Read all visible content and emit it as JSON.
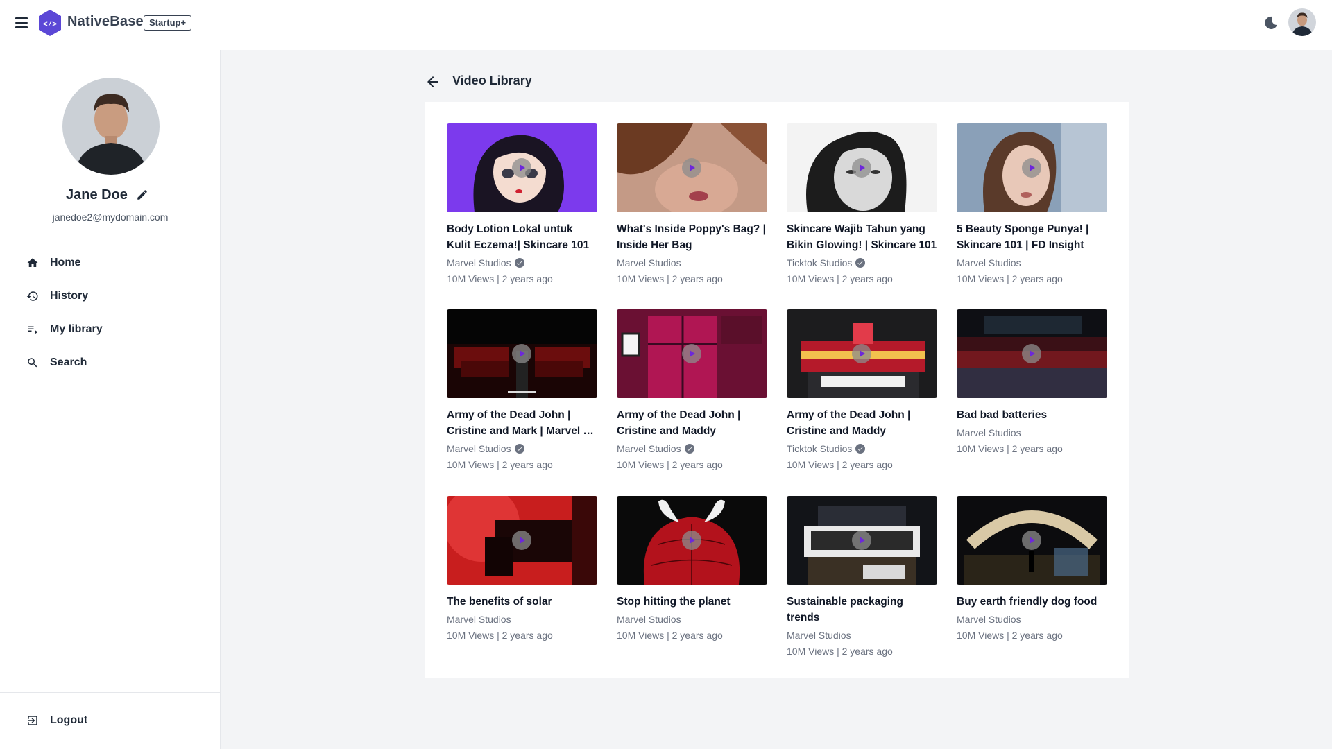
{
  "header": {
    "brand": "NativeBase",
    "badge": "Startup+",
    "icons": [
      "hamburger-menu-icon",
      "logo-icon",
      "moon-icon",
      "user-avatar"
    ]
  },
  "sidebar": {
    "profile": {
      "name": "Jane Doe",
      "email": "janedoe2@mydomain.com"
    },
    "items": [
      {
        "label": "Home",
        "icon": "home-icon"
      },
      {
        "label": "History",
        "icon": "history-icon"
      },
      {
        "label": "My library",
        "icon": "library-icon"
      },
      {
        "label": "Search",
        "icon": "search-icon"
      }
    ],
    "logout": {
      "label": "Logout",
      "icon": "logout-icon"
    }
  },
  "main": {
    "title": "Video Library",
    "videos": [
      {
        "title": "Body Lotion Lokal untuk Kulit Eczema!| Skincare 101",
        "channel": "Marvel Studios",
        "verified": true,
        "meta": "10M Views | 2 years ago"
      },
      {
        "title": "What's Inside Poppy's Bag? | Inside Her Bag",
        "channel": "Marvel Studios",
        "verified": false,
        "meta": "10M Views | 2 years ago"
      },
      {
        "title": "Skincare Wajib Tahun yang Bikin Glowing! | Skincare 101",
        "channel": "Ticktok Studios",
        "verified": true,
        "meta": "10M Views | 2 years ago"
      },
      {
        "title": "5 Beauty Sponge Punya! | Skincare 101 | FD Insight",
        "channel": "Marvel Studios",
        "verified": false,
        "meta": "10M Views | 2 years ago"
      },
      {
        "title": "Army of the Dead John | Cristine and Mark | Marvel …",
        "channel": "Marvel Studios",
        "verified": true,
        "meta": "10M Views | 2 years ago"
      },
      {
        "title": "Army of the Dead John | Cristine and Maddy",
        "channel": "Marvel Studios",
        "verified": true,
        "meta": "10M Views | 2 years ago"
      },
      {
        "title": "Army of the Dead John | Cristine and Maddy",
        "channel": "Ticktok Studios",
        "verified": true,
        "meta": "10M Views | 2 years ago"
      },
      {
        "title": "Bad bad batteries",
        "channel": "Marvel Studios",
        "verified": false,
        "meta": "10M Views | 2 years ago"
      },
      {
        "title": "The benefits of solar",
        "channel": "Marvel Studios",
        "verified": false,
        "meta": "10M Views | 2 years ago"
      },
      {
        "title": "Stop hitting the planet",
        "channel": "Marvel Studios",
        "verified": false,
        "meta": "10M Views | 2 years ago"
      },
      {
        "title": "Sustainable packaging trends",
        "channel": "Marvel Studios",
        "verified": false,
        "meta": "10M Views | 2 years ago"
      },
      {
        "title": "Buy earth friendly dog food",
        "channel": "Marvel Studios",
        "verified": false,
        "meta": "10M Views | 2 years ago"
      }
    ]
  },
  "colors": {
    "brand": "#5b47d6",
    "page_bg": "#f3f4f6",
    "text": "#111827",
    "muted": "#6b7280"
  }
}
